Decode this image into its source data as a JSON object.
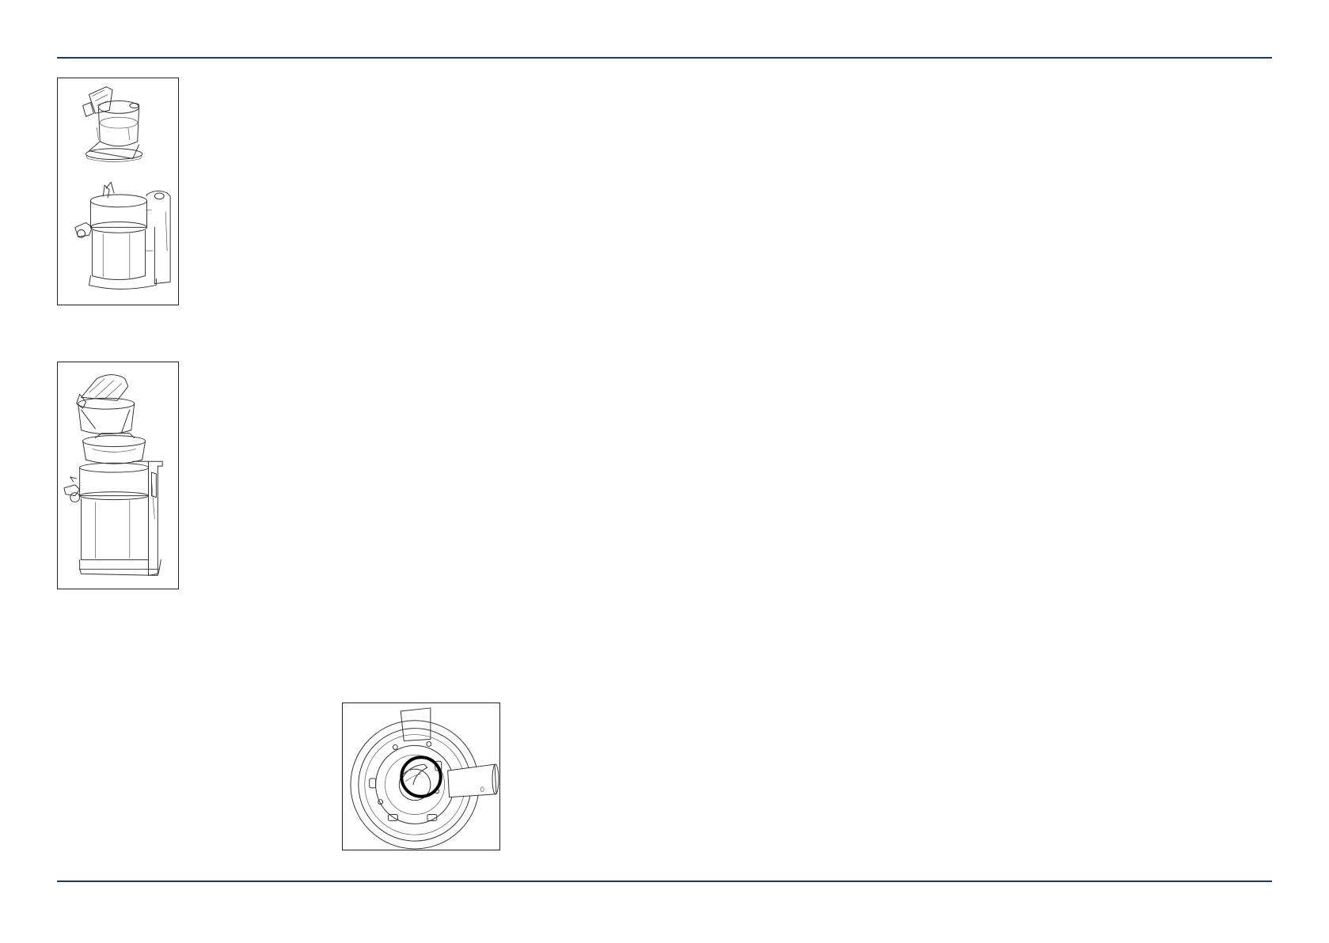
{
  "page": {
    "rule_color": "#1f3a5f",
    "figures": [
      {
        "id": "fig1",
        "subject": "juicer-juicing-bowl-assembly-icon"
      },
      {
        "id": "fig2",
        "subject": "juicer-complete-assembly-icon"
      },
      {
        "id": "fig3",
        "subject": "juicer-bowl-top-view-icon",
        "highlight_color": "#000000"
      }
    ]
  }
}
